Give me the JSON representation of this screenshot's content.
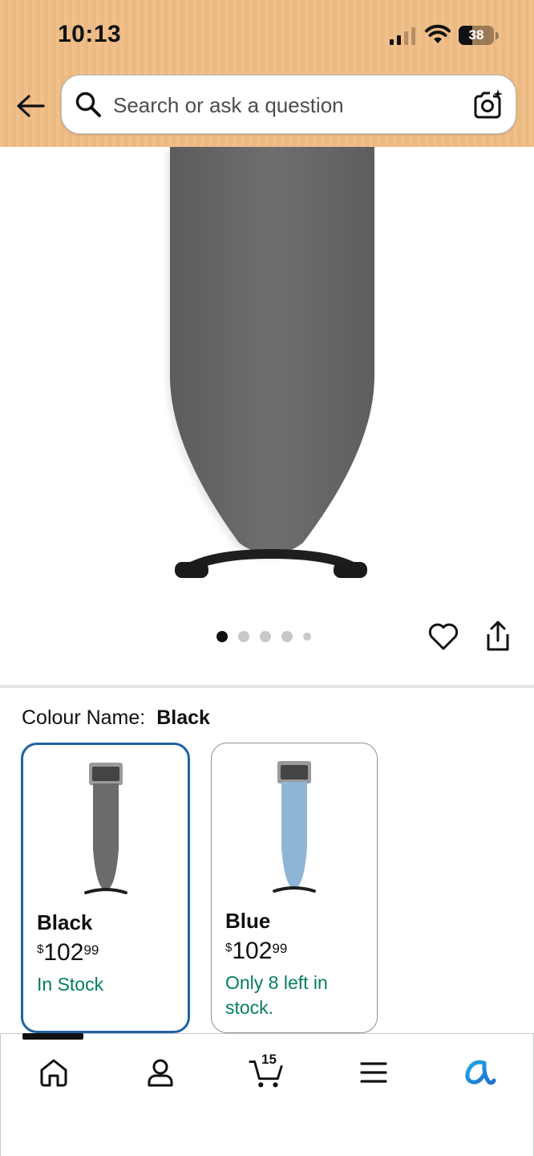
{
  "status_bar": {
    "time": "10:13",
    "battery": "38",
    "battery_level": 0.38
  },
  "header": {
    "back_icon": "arrow-left-icon",
    "search_placeholder": "Search or ask a question",
    "search_icon": "search-icon",
    "camera_icon": "camera-sparkle-icon"
  },
  "product": {
    "image_count": 5,
    "active_image_index": 0,
    "wishlist_icon": "heart-icon",
    "share_icon": "share-icon"
  },
  "colour": {
    "label": "Colour Name:",
    "selected_value": "Black",
    "options": [
      {
        "name": "Black",
        "price_symbol": "$",
        "price_whole": "102",
        "price_cents": "99",
        "stock": "In Stock",
        "board_color": "#6b6b6d",
        "selected": true
      },
      {
        "name": "Blue",
        "price_symbol": "$",
        "price_whole": "102",
        "price_cents": "99",
        "stock": "Only 8 left in stock.",
        "board_color": "#8fb5d6",
        "selected": false
      }
    ]
  },
  "bottom_nav": {
    "items": [
      "home-icon",
      "account-icon",
      "cart-icon",
      "menu-icon",
      "rufus-ai-icon"
    ],
    "cart_count": "15",
    "active_index": 0
  },
  "colors": {
    "header_bg": "#efc08b",
    "selected_border": "#2162a1",
    "stock_green": "#067d62",
    "board_dark": "#6b6b6d"
  }
}
